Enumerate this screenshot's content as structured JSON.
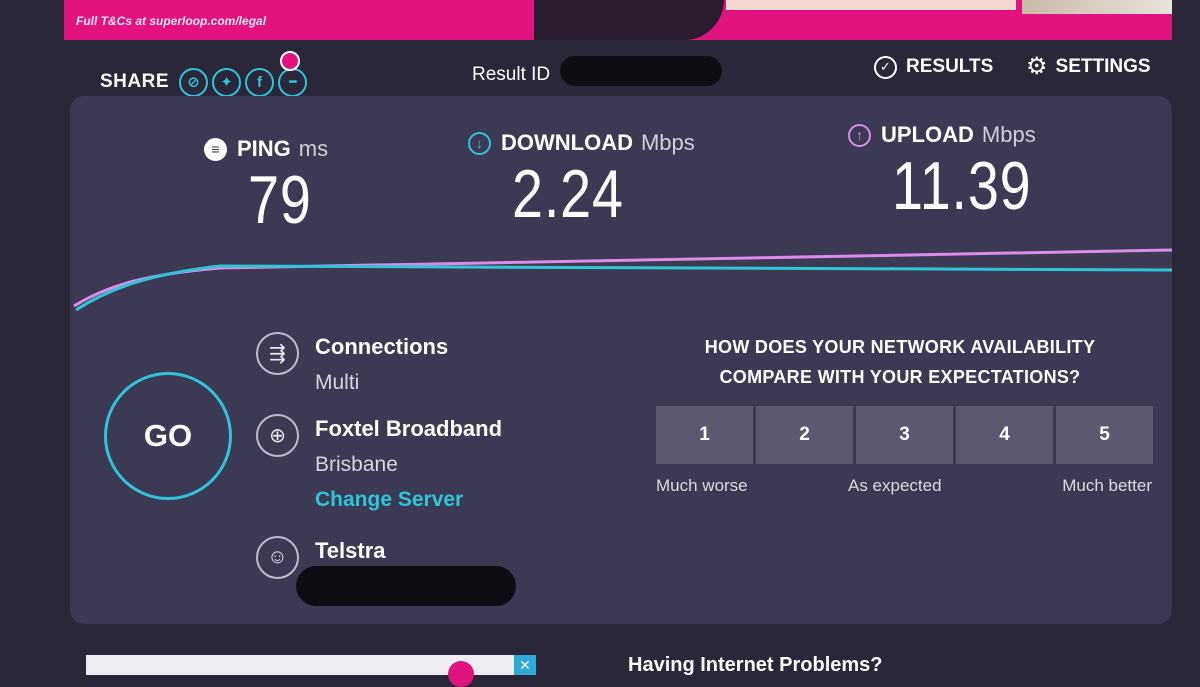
{
  "ad": {
    "legal": "Full T&Cs at superloop.com/legal"
  },
  "share": {
    "label": "SHARE",
    "icons": [
      {
        "name": "link-icon",
        "glyph": "⊘"
      },
      {
        "name": "twitter-icon",
        "glyph": "✦"
      },
      {
        "name": "facebook-icon",
        "glyph": "f"
      },
      {
        "name": "more-icon",
        "glyph": "•••"
      }
    ]
  },
  "result": {
    "label": "Result ID"
  },
  "nav": {
    "results": "RESULTS",
    "settings": "SETTINGS"
  },
  "metrics": {
    "ping": {
      "label": "PING",
      "unit": "ms",
      "value": "79"
    },
    "download": {
      "label": "DOWNLOAD",
      "unit": "Mbps",
      "value": "2.24"
    },
    "upload": {
      "label": "UPLOAD",
      "unit": "Mbps",
      "value": "11.39"
    }
  },
  "colors": {
    "accent": "#2fc4d8",
    "upload": "#d98ce8",
    "brand": "#e0137f"
  },
  "go": "GO",
  "connections": {
    "title": "Connections",
    "value": "Multi"
  },
  "server": {
    "name": "Foxtel Broadband",
    "city": "Brisbane",
    "change": "Change Server"
  },
  "isp": {
    "name": "Telstra"
  },
  "survey": {
    "question": "HOW DOES YOUR NETWORK AVAILABILITY COMPARE WITH YOUR EXPECTATIONS?",
    "options": [
      "1",
      "2",
      "3",
      "4",
      "5"
    ],
    "labels": {
      "low": "Much worse",
      "mid": "As expected",
      "high": "Much better"
    }
  },
  "bottom": {
    "problems": "Having Internet Problems?"
  }
}
